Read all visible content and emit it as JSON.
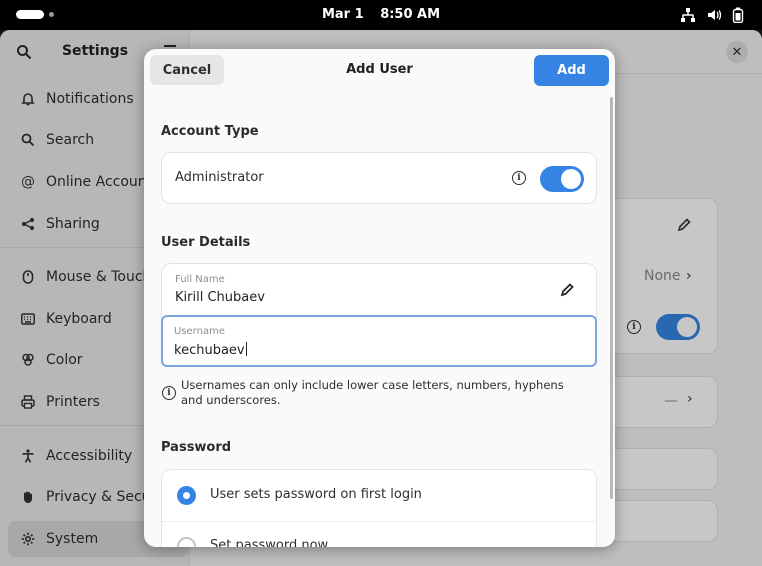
{
  "topbar": {
    "date": "Mar 1",
    "time": "8:50 AM"
  },
  "sidebar": {
    "title": "Settings",
    "items": [
      {
        "label": "Notifications",
        "icon": "bell-icon"
      },
      {
        "label": "Search",
        "icon": "search-icon"
      },
      {
        "label": "Online Accounts",
        "icon": "at-icon"
      },
      {
        "label": "Sharing",
        "icon": "share-icon"
      },
      {
        "label": "Mouse & Touchpad",
        "icon": "mouse-icon"
      },
      {
        "label": "Keyboard",
        "icon": "keyboard-icon"
      },
      {
        "label": "Color",
        "icon": "palette-icon"
      },
      {
        "label": "Printers",
        "icon": "printer-icon"
      },
      {
        "label": "Accessibility",
        "icon": "accessibility-icon"
      },
      {
        "label": "Privacy & Security",
        "icon": "hand-icon"
      },
      {
        "label": "System",
        "icon": "gear-icon"
      }
    ]
  },
  "background": {
    "none_label": "None",
    "dash_label": "—"
  },
  "dialog": {
    "title": "Add User",
    "cancel_label": "Cancel",
    "add_label": "Add",
    "account_type": {
      "section_title": "Account Type",
      "administrator_label": "Administrator",
      "administrator_enabled": true
    },
    "user_details": {
      "section_title": "User Details",
      "full_name_caption": "Full Name",
      "full_name_value": "Kirill Chubaev",
      "username_caption": "Username",
      "username_value": "kechubaev",
      "hint": "Usernames can only include lower case letters, numbers, hyphens and underscores."
    },
    "password": {
      "section_title": "Password",
      "option_first_login": "User sets password on first login",
      "option_set_now": "Set password now",
      "selected": "first_login"
    }
  },
  "colors": {
    "accent": "#3584e4",
    "topbar": "#000000"
  }
}
